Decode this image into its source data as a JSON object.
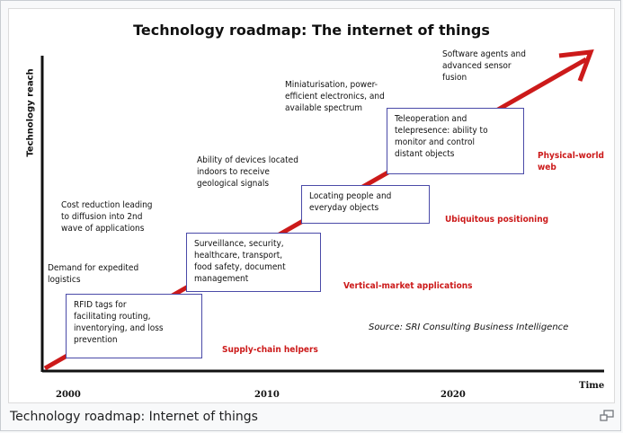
{
  "figure": {
    "title": "Technology roadmap: The internet of things",
    "y_axis_label": "Technology reach",
    "x_axis_label": "Time",
    "ticks": [
      "2000",
      "2010",
      "2020"
    ],
    "boxes": [
      "RFID tags for\nfacilitating routing,\ninventorying, and loss\nprevention",
      "Surveillance, security,\nhealthcare, transport,\nfood safety, document\nmanagement",
      "Locating people and\neveryday objects",
      "Teleoperation and\ntelepresence: ability to\nmonitor and control\ndistant objects"
    ],
    "drivers": [
      "Demand for expedited\nlogistics",
      "Cost reduction leading\nto diffusion into 2nd\nwave of applications",
      "Ability of devices located\nindoors to receive\ngeological signals",
      "Miniaturisation, power-\nefficient electronics, and\navailable spectrum",
      "Software agents and\nadvanced sensor\nfusion"
    ],
    "phases": [
      "Supply-chain helpers",
      "Vertical-market applications",
      "Ubiquitous positioning",
      "Physical-world\nweb"
    ],
    "source": "Source: SRI Consulting Business Intelligence",
    "colors": {
      "arrow": "#cc1a1a",
      "box_border": "#4a4aa8",
      "phase_text": "#cc1a1a"
    }
  },
  "caption": "Technology roadmap: Internet of things",
  "icons": {
    "enlarge": "magnify-clip-icon"
  }
}
